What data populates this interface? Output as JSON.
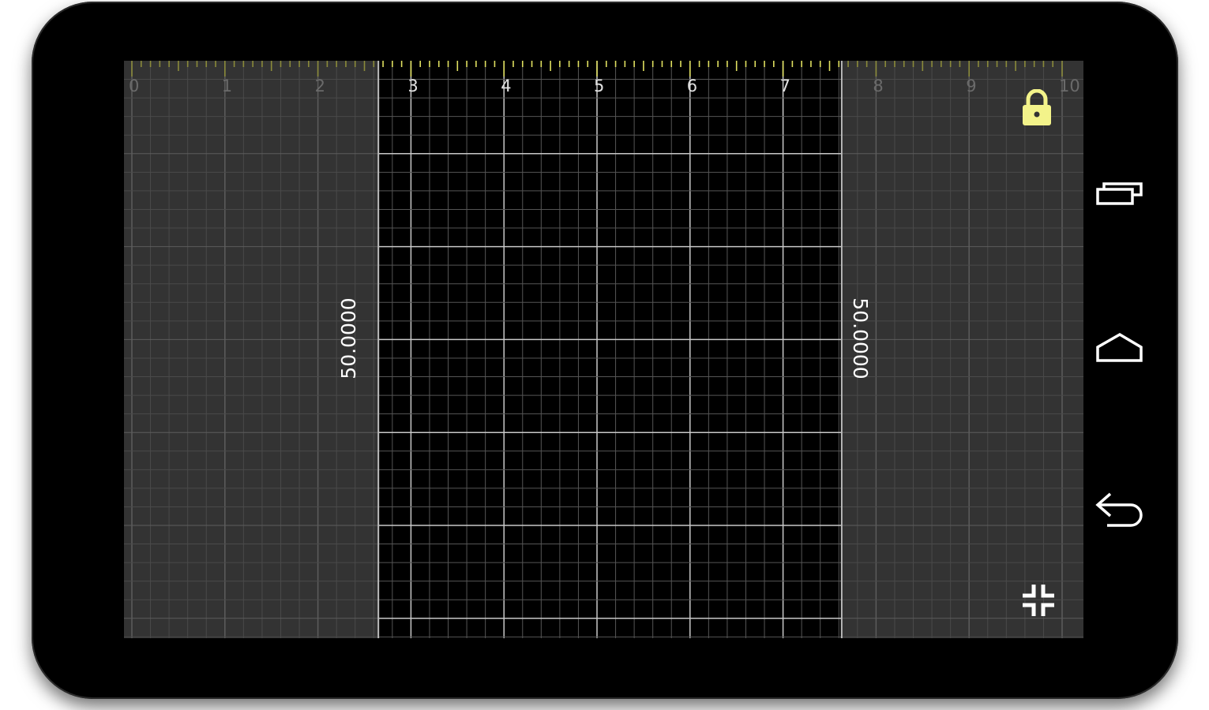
{
  "ruler": {
    "min": 0,
    "max": 10,
    "major_ticks": [
      "0",
      "1",
      "2",
      "3",
      "4",
      "5",
      "6",
      "7",
      "8",
      "9",
      "10"
    ],
    "selection_start": 2.65,
    "selection_end": 7.63,
    "tick_color": "#e0e060",
    "tick_color_dim": "#8a8a3a"
  },
  "measurement": {
    "left_value": "50.0000",
    "right_value": "50.0000"
  },
  "colors": {
    "shaded_area": "#333333",
    "selected_area": "#000000",
    "grid_line": "#4a4a4a",
    "grid_line_major": "#5c5c5c",
    "selected_grid_line": "#555555",
    "selected_grid_line_major": "#c8c8c8",
    "lock_accent": "#f3f38a",
    "nav_icon": "#ffffff"
  },
  "icons": {
    "lock": "lock-icon",
    "collapse": "collapse-icon",
    "recents": "recents-icon",
    "home": "home-icon",
    "back": "back-icon"
  }
}
